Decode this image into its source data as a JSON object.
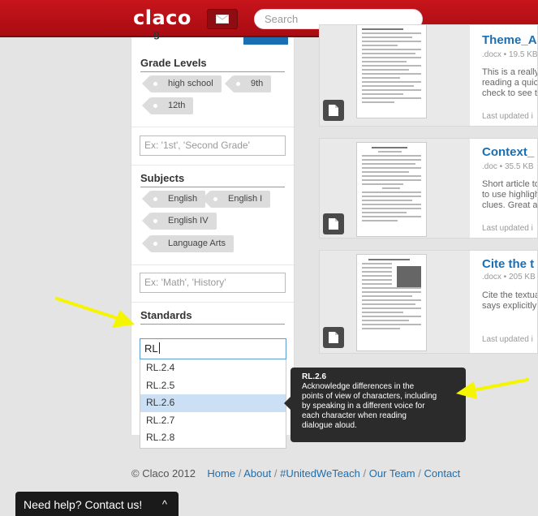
{
  "header": {
    "logo": "claco",
    "search_placeholder": "Search"
  },
  "sidebar": {
    "cut_heading": "g",
    "grade_levels": {
      "title": "Grade Levels",
      "tags": [
        "high school",
        "9th",
        "12th"
      ],
      "placeholder": "Ex: '1st', 'Second Grade'"
    },
    "subjects": {
      "title": "Subjects",
      "tags": [
        "English",
        "English I",
        "English IV",
        "Language Arts"
      ],
      "placeholder": "Ex: 'Math', 'History'"
    },
    "standards": {
      "title": "Standards",
      "input_value": "RL",
      "options": [
        "RL.2.4",
        "RL.2.5",
        "RL.2.6",
        "RL.2.7",
        "RL.2.8"
      ],
      "selected": "RL.2.6"
    }
  },
  "tooltip": {
    "code": "RL.2.6",
    "lines": [
      "Acknowledge differences in the",
      "points of view of characters, including",
      "by speaking in a different voice for",
      "each character when reading",
      "dialogue aloud."
    ]
  },
  "results": [
    {
      "title": "Theme_A",
      "meta": ".docx • 19.5 KB",
      "desc": [
        "This is a really",
        "reading a quic",
        "check to see t"
      ],
      "updated": "Last updated i"
    },
    {
      "title": "Context_",
      "meta": ".doc • 35.5 KB",
      "desc": [
        "Short article to",
        "to use highligh",
        "clues.  Great a"
      ],
      "updated": "Last updated i"
    },
    {
      "title": "Cite the t",
      "meta": ".docx • 205 KB",
      "desc": [
        "Cite the textua",
        "says explicitly"
      ],
      "updated": "Last updated i"
    }
  ],
  "footer": {
    "copyright": "© Claco 2012",
    "links": [
      "Home",
      "About",
      "#UnitedWeTeach",
      "Our Team",
      "Contact"
    ]
  },
  "help": {
    "label": "Need help? Contact us!",
    "chevron": "^"
  },
  "colors": {
    "brand_red": "#c8141b",
    "link_blue": "#1a6fb3",
    "annotation_yellow": "#f5f500"
  }
}
